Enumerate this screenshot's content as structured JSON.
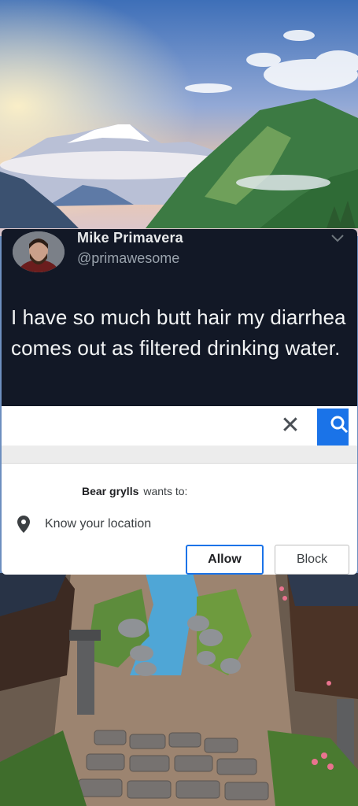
{
  "tweet": {
    "name": "Mike Primavera",
    "handle": "@primawesome",
    "text": "I have so much butt hair my diarrhea comes out as filtered drinking water."
  },
  "popup": {
    "close_icon": "close-icon",
    "search_icon": "search-icon",
    "requester": "Bear grylls",
    "request_verb": "wants to:",
    "permission_icon": "location-pin-icon",
    "permission_text": "Know your location",
    "allow_label": "Allow",
    "block_label": "Block"
  },
  "colors": {
    "tweet_bg": "#121826",
    "accent_blue": "#1a73e8"
  }
}
